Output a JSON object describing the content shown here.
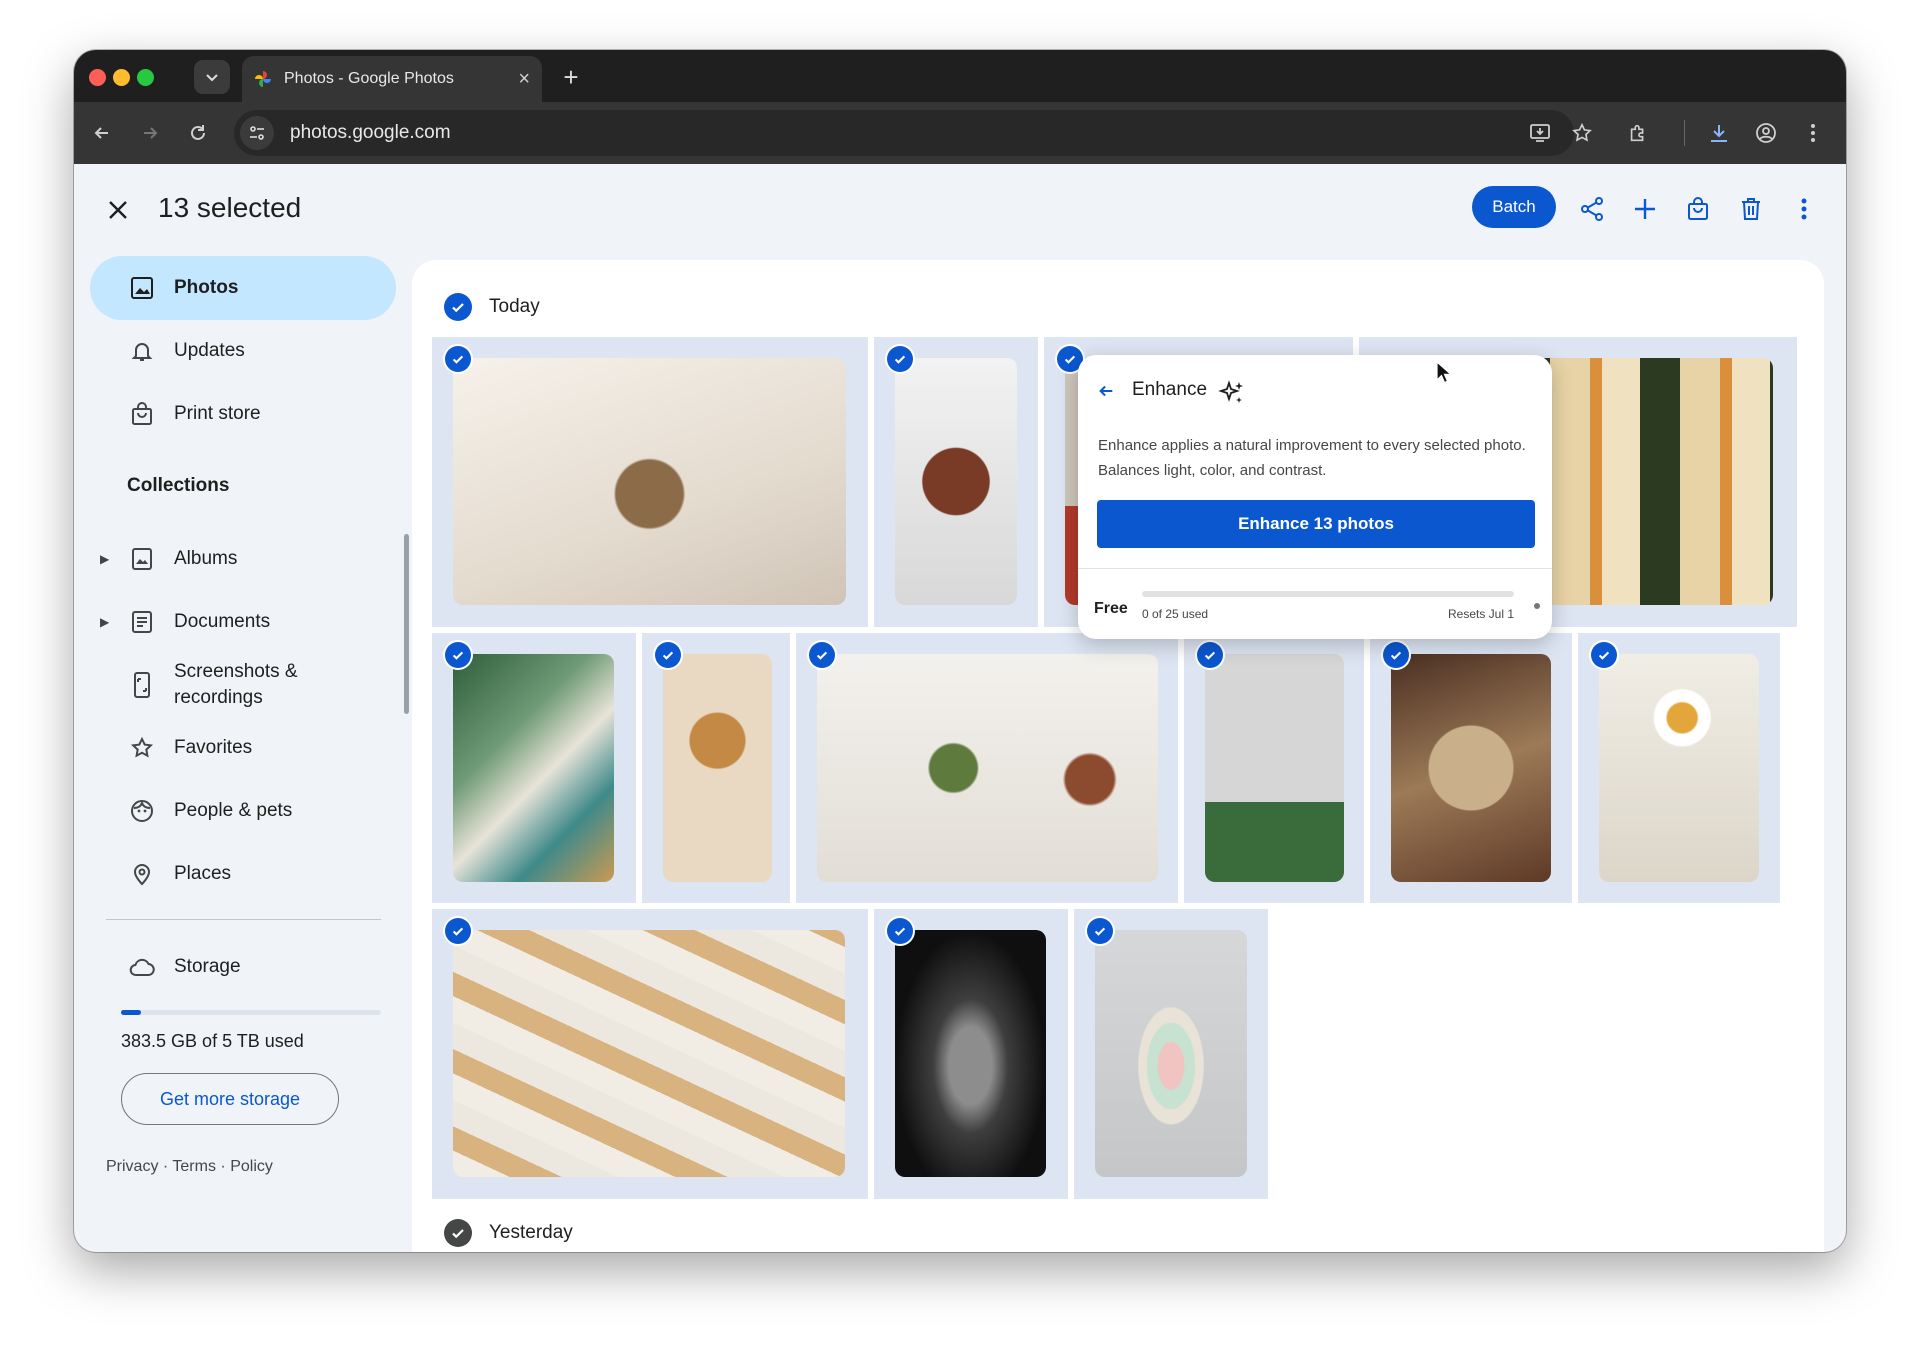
{
  "browser": {
    "tab_title": "Photos - Google Photos",
    "url": "photos.google.com",
    "traffic_lights": {
      "close": "#ff5f57",
      "minimize": "#febc2e",
      "maximize": "#28c840"
    }
  },
  "header": {
    "selected_count": "13 selected",
    "batch_label": "Batch",
    "actions": [
      "share-icon",
      "add-icon",
      "shopping-bag-icon",
      "delete-icon",
      "more-vert-icon"
    ]
  },
  "sidebar": {
    "nav": [
      {
        "label": "Photos",
        "icon": "photo-icon",
        "active": true
      },
      {
        "label": "Updates",
        "icon": "bell-icon"
      },
      {
        "label": "Print store",
        "icon": "shopping-bag-icon"
      }
    ],
    "collections_heading": "Collections",
    "collections": [
      {
        "label": "Albums",
        "icon": "album-icon",
        "expandable": true
      },
      {
        "label": "Documents",
        "icon": "document-icon",
        "expandable": true
      },
      {
        "label": "Screenshots & recordings",
        "icon": "phone-icon"
      },
      {
        "label": "Favorites",
        "icon": "star-icon"
      },
      {
        "label": "People & pets",
        "icon": "face-icon"
      },
      {
        "label": "Places",
        "icon": "location-icon"
      }
    ],
    "storage": {
      "label": "Storage",
      "used_text": "383.5 GB of 5 TB used",
      "fraction_used": 0.077,
      "button": "Get more storage"
    },
    "footer": [
      "Privacy",
      "Terms",
      "Policy"
    ]
  },
  "content": {
    "sections": [
      {
        "label": "Today"
      },
      {
        "label": "Yesterday"
      }
    ]
  },
  "enhance_popup": {
    "title": "Enhance",
    "description": "Enhance applies a natural improvement to every selected photo. Balances light, color, and contrast.",
    "button": "Enhance 13 photos",
    "plan": "Free",
    "usage": "0 of 25 used",
    "resets": "Resets Jul 1"
  },
  "colors": {
    "accent": "#0b57d0",
    "active_nav": "#c2e7ff",
    "selection_bg": "#dde5f3"
  }
}
